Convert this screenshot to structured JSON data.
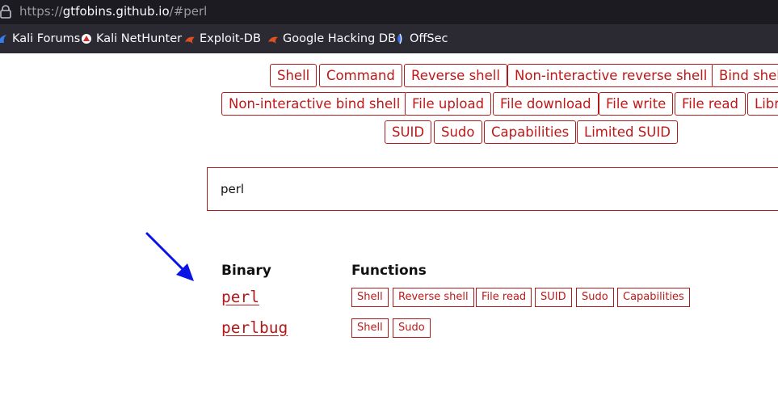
{
  "browser": {
    "url_prefix": "https://",
    "url_host": "gtfobins.github.io",
    "url_path": "/#perl",
    "bookmarks": [
      {
        "label": "Kali Forums",
        "icon": "kali-dragon-icon"
      },
      {
        "label": "Kali NetHunter",
        "icon": "nethunter-icon"
      },
      {
        "label": "Exploit-DB",
        "icon": "exploit-db-icon"
      },
      {
        "label": "Google Hacking DB",
        "icon": "ghdb-icon"
      },
      {
        "label": "OffSec",
        "icon": "offsec-icon"
      }
    ]
  },
  "filters": {
    "row1": [
      "Shell",
      "Command",
      "Reverse shell",
      "Non-interactive reverse shell",
      "Bind shell"
    ],
    "row2": [
      "Non-interactive bind shell",
      "File upload",
      "File download",
      "File write",
      "File read",
      "Library load"
    ],
    "row3": [
      "SUID",
      "Sudo",
      "Capabilities",
      "Limited SUID"
    ]
  },
  "search": {
    "value": "perl"
  },
  "results": {
    "headers": {
      "binary": "Binary",
      "functions": "Functions"
    },
    "rows": [
      {
        "binary": "perl",
        "functions": [
          "Shell",
          "Reverse shell",
          "File read",
          "SUID",
          "Sudo",
          "Capabilities"
        ]
      },
      {
        "binary": "perlbug",
        "functions": [
          "Shell",
          "Sudo"
        ]
      }
    ]
  },
  "colors": {
    "accent": "#b01a1a",
    "annotation_arrow": "#0a14e6"
  }
}
